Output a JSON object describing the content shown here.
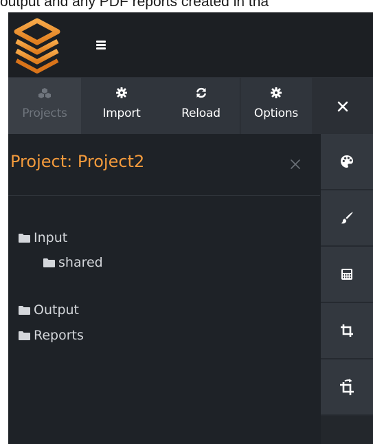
{
  "caption": "output and any PDF reports created in tha",
  "header": {
    "logo_icon": "layers-logo-icon",
    "menu_icon": "hamburger-menu-icon"
  },
  "toolbar": {
    "projects_label": "Projects",
    "import_label": "Import",
    "reload_label": "Reload",
    "options_label": "Options",
    "close_icon": "close-icon"
  },
  "panel": {
    "title": "Project: Project2",
    "close_icon": "close-icon"
  },
  "tree": {
    "items": [
      {
        "label": "Input",
        "icon": "folder-icon"
      },
      {
        "label": "shared",
        "icon": "folder-icon"
      },
      {
        "label": "Output",
        "icon": "folder-icon"
      },
      {
        "label": "Reports",
        "icon": "folder-icon"
      }
    ]
  },
  "side_rail": {
    "buttons": [
      {
        "icon": "palette-icon"
      },
      {
        "icon": "brush-icon"
      },
      {
        "icon": "calculator-icon"
      },
      {
        "icon": "crop-icon"
      },
      {
        "icon": "crop-rotate-icon"
      }
    ]
  },
  "colors": {
    "accent": "#f39a3c",
    "background": "#1e2227",
    "toolbar": "#30353c"
  }
}
